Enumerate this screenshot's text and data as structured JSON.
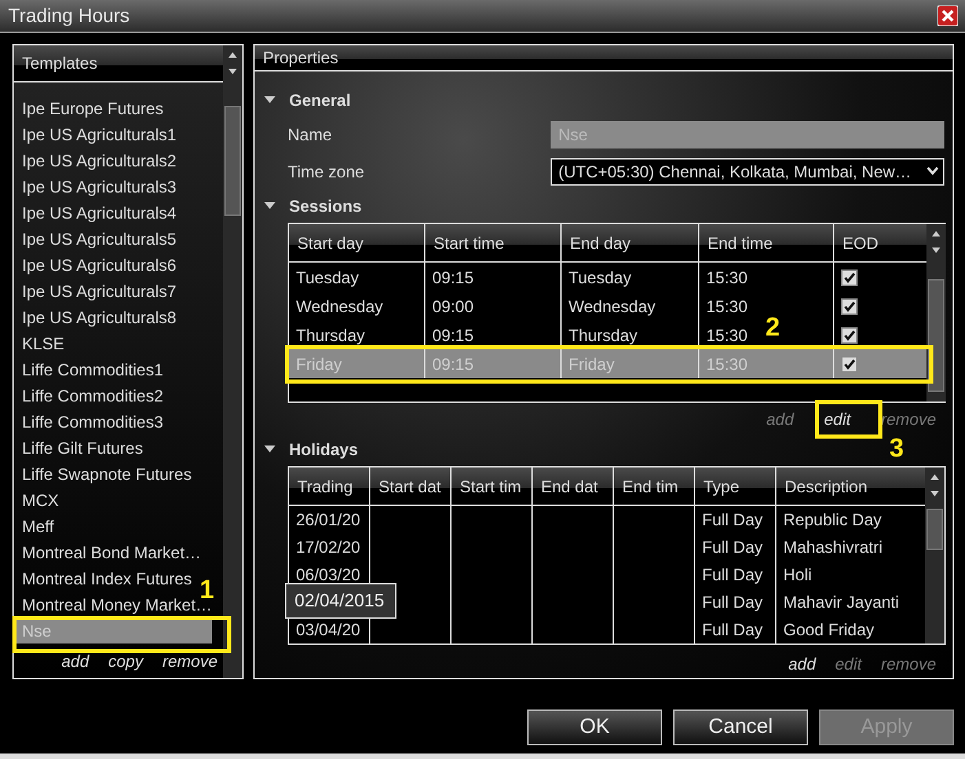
{
  "window": {
    "title": "Trading Hours"
  },
  "templates": {
    "title": "Templates",
    "items": [
      {
        "label": "Ipe Europe Futures",
        "selected": false
      },
      {
        "label": "Ipe US Agriculturals1",
        "selected": false
      },
      {
        "label": "Ipe US Agriculturals2",
        "selected": false
      },
      {
        "label": "Ipe US Agriculturals3",
        "selected": false
      },
      {
        "label": "Ipe US Agriculturals4",
        "selected": false
      },
      {
        "label": "Ipe US Agriculturals5",
        "selected": false
      },
      {
        "label": "Ipe US Agriculturals6",
        "selected": false
      },
      {
        "label": "Ipe US Agriculturals7",
        "selected": false
      },
      {
        "label": "Ipe US Agriculturals8",
        "selected": false
      },
      {
        "label": "KLSE",
        "selected": false
      },
      {
        "label": "Liffe Commodities1",
        "selected": false
      },
      {
        "label": "Liffe Commodities2",
        "selected": false
      },
      {
        "label": "Liffe Commodities3",
        "selected": false
      },
      {
        "label": "Liffe Gilt Futures",
        "selected": false
      },
      {
        "label": "Liffe Swapnote Futures",
        "selected": false
      },
      {
        "label": "MCX",
        "selected": false
      },
      {
        "label": "Meff",
        "selected": false
      },
      {
        "label": "Montreal Bond Market…",
        "selected": false
      },
      {
        "label": "Montreal Index Futures",
        "selected": false
      },
      {
        "label": "Montreal Money Market…",
        "selected": false
      },
      {
        "label": "Nse",
        "selected": true
      }
    ],
    "actions": [
      {
        "label": "add",
        "disabled": false
      },
      {
        "label": "copy",
        "disabled": false
      },
      {
        "label": "remove",
        "disabled": false
      }
    ]
  },
  "properties": {
    "title": "Properties",
    "general": {
      "title": "General",
      "expanded": true,
      "name_label": "Name",
      "name_value": "Nse",
      "timezone_label": "Time zone",
      "timezone_value": "(UTC+05:30) Chennai, Kolkata, Mumbai, New…"
    },
    "sessions": {
      "title": "Sessions",
      "expanded": true,
      "columns": [
        "Start day",
        "Start time",
        "End day",
        "End time",
        "EOD"
      ],
      "rows": [
        {
          "start_day": "Tuesday",
          "start_time": "09:15",
          "end_day": "Tuesday",
          "end_time": "15:30",
          "eod": true,
          "selected": false
        },
        {
          "start_day": "Wednesday",
          "start_time": "09:00",
          "end_day": "Wednesday",
          "end_time": "15:30",
          "eod": true,
          "selected": false
        },
        {
          "start_day": "Thursday",
          "start_time": "09:15",
          "end_day": "Thursday",
          "end_time": "15:30",
          "eod": true,
          "selected": false
        },
        {
          "start_day": "Friday",
          "start_time": "09:15",
          "end_day": "Friday",
          "end_time": "15:30",
          "eod": true,
          "selected": true
        }
      ],
      "actions": [
        {
          "label": "add",
          "disabled": true
        },
        {
          "label": "edit",
          "disabled": false
        },
        {
          "label": "remove",
          "disabled": true
        }
      ]
    },
    "holidays": {
      "title": "Holidays",
      "expanded": true,
      "columns": [
        "Trading",
        "Start dat",
        "Start tim",
        "End dat",
        "End tim",
        "Type",
        "Description"
      ],
      "rows": [
        {
          "trading": "26/01/20",
          "type": "Full Day",
          "description": "Republic Day"
        },
        {
          "trading": "17/02/20",
          "type": "Full Day",
          "description": "Mahashivratri"
        },
        {
          "trading": "06/03/20",
          "type": "Full Day",
          "description": "Holi"
        },
        {
          "type": "Full Day",
          "description": "Mahavir Jayanti"
        },
        {
          "trading": "03/04/20",
          "type": "Full Day",
          "description": "Good Friday"
        }
      ],
      "tooltip": "02/04/2015",
      "actions": [
        {
          "label": "add",
          "disabled": false
        },
        {
          "label": "edit",
          "disabled": true
        },
        {
          "label": "remove",
          "disabled": true
        }
      ]
    }
  },
  "buttons": [
    {
      "label": "OK",
      "disabled": false
    },
    {
      "label": "Cancel",
      "disabled": false
    },
    {
      "label": "Apply",
      "disabled": true
    }
  ],
  "callouts": [
    "1",
    "2",
    "3"
  ]
}
